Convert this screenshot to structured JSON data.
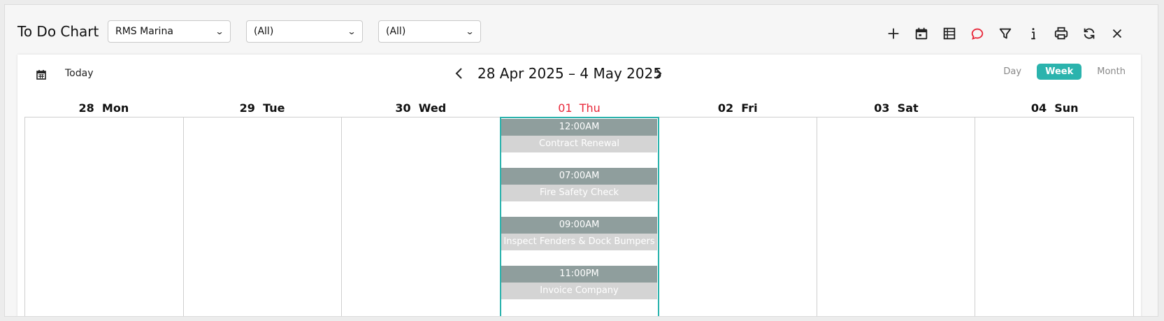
{
  "header": {
    "title": "To Do Chart",
    "filters": [
      {
        "value": "RMS Marina"
      },
      {
        "value": "(All)"
      },
      {
        "value": "(All)"
      }
    ],
    "toolbar_icons": [
      "plus-icon",
      "calendar-icon",
      "list-icon",
      "comment-icon",
      "filter-icon",
      "info-icon",
      "print-icon",
      "refresh-icon",
      "close-icon"
    ],
    "accent_comment": "#e8283a"
  },
  "calendar": {
    "today_label": "Today",
    "range": "28 Apr 2025 – 4 May 2025",
    "views": [
      {
        "label": "Day",
        "active": false
      },
      {
        "label": "Week",
        "active": true
      },
      {
        "label": "Month",
        "active": false
      }
    ],
    "accent": "#2bb3ad",
    "days": [
      {
        "num": "28",
        "name": "Mon"
      },
      {
        "num": "29",
        "name": "Tue"
      },
      {
        "num": "30",
        "name": "Wed"
      },
      {
        "num": "01",
        "name": "Thu"
      },
      {
        "num": "02",
        "name": "Fri"
      },
      {
        "num": "03",
        "name": "Sat"
      },
      {
        "num": "04",
        "name": "Sun"
      }
    ],
    "events": [
      {
        "time": "12:00AM",
        "title": "Contract Renewal"
      },
      {
        "time": "07:00AM",
        "title": "Fire Safety Check"
      },
      {
        "time": "09:00AM",
        "title": "Inspect Fenders & Dock Bumpers"
      },
      {
        "time": "11:00PM",
        "title": "Invoice Company"
      }
    ]
  }
}
